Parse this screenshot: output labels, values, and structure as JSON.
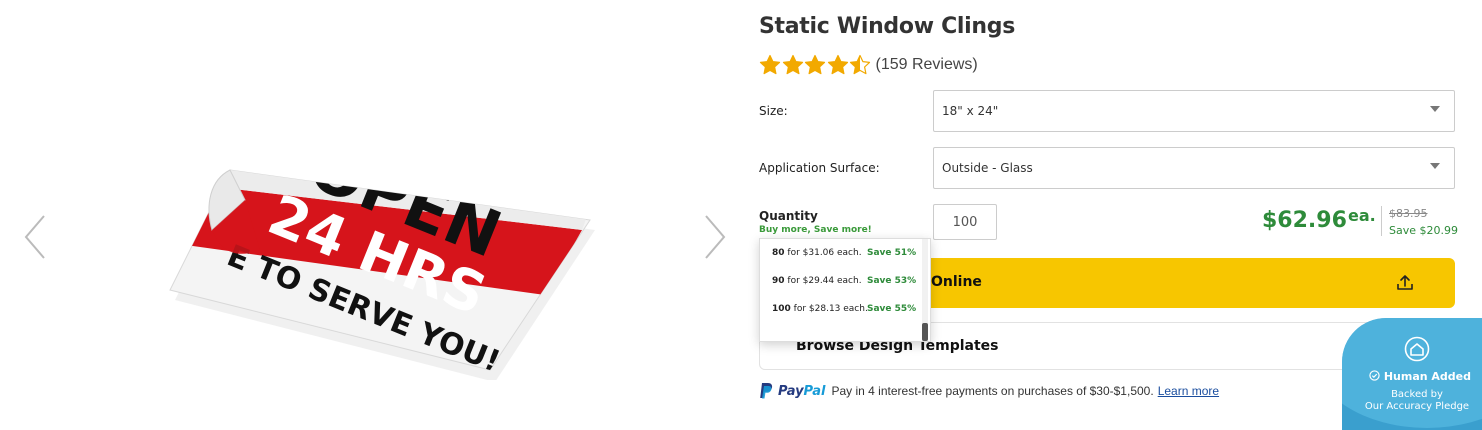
{
  "product": {
    "title": "Static Window Clings",
    "rating": 4.5,
    "reviews": "(159 Reviews)"
  },
  "options": {
    "size_label": "Size:",
    "size_value": "18\" x 24\"",
    "surface_label": "Application Surface:",
    "surface_value": "Outside - Glass"
  },
  "quantity": {
    "label": "Quantity",
    "sublabel": "Buy more, Save more!",
    "value": "100"
  },
  "price": {
    "current": "$62.96",
    "unit": "ea.",
    "old": "$83.95",
    "save": "Save $20.99"
  },
  "tiers": [
    {
      "qty": "80",
      "each": "for $31.06 each.",
      "save": "Save 51%"
    },
    {
      "qty": "90",
      "each": "for $29.44 each.",
      "save": "Save 53%"
    },
    {
      "qty": "100",
      "each": "for $28.13 each.",
      "save": "Save 55%"
    }
  ],
  "buttons": {
    "design_online": "Online",
    "browse_templates": "Browse Design Templates"
  },
  "paypal": {
    "brand_pay": "Pay",
    "brand_pal": "Pal",
    "text": "Pay in 4 interest-free payments on purchases of $30-$1,500.",
    "link": "Learn more"
  },
  "badge": {
    "title": "Human Added",
    "line2": "Backed by",
    "line3": "Our Accuracy Pledge"
  },
  "image": {
    "line1": "OPEN",
    "line2": "24 HRS",
    "line3": "E TO SERVE YOU!"
  },
  "colors": {
    "accent_yellow": "#f7c600",
    "price_green": "#2e8b3a",
    "star_gold": "#f2a900",
    "badge_blue": "#3a9fce"
  }
}
